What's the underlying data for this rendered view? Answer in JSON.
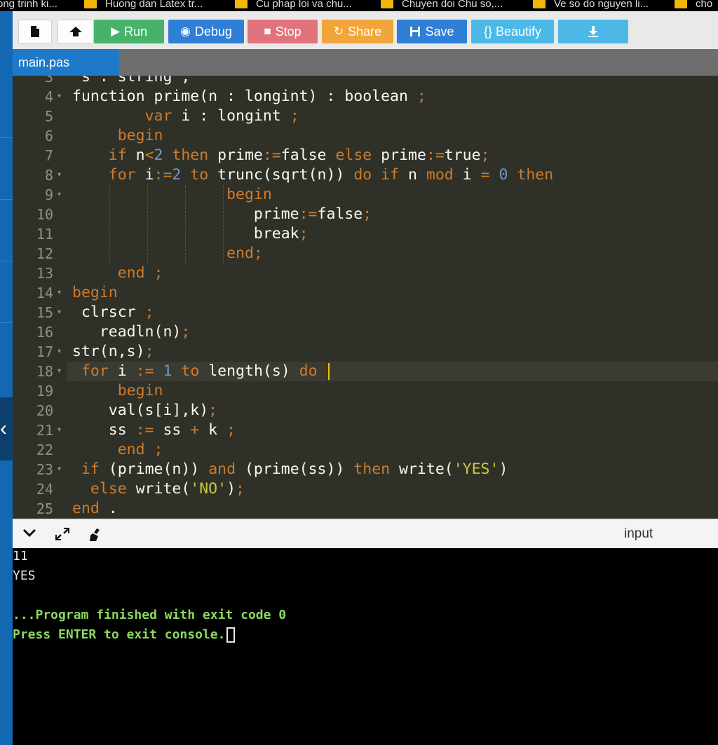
{
  "bookmarks": [
    {
      "label": "ong trinh ki..."
    },
    {
      "label": "Huong dan Latex tr..."
    },
    {
      "label": "Cu phap loi va chu..."
    },
    {
      "label": "Chuyen doi Chu so,..."
    },
    {
      "label": "Ve so do nguyen li..."
    },
    {
      "label": "cho"
    }
  ],
  "toolbar": {
    "run_label": "Run",
    "debug_label": "Debug",
    "stop_label": "Stop",
    "share_label": "Share",
    "save_label": "Save",
    "beautify_label": "{} Beautify"
  },
  "tab": {
    "name": "main.pas"
  },
  "editor": {
    "line_numbers": [
      "3",
      "4",
      "5",
      "6",
      "7",
      "8",
      "9",
      "10",
      "11",
      "12",
      "13",
      "14",
      "15",
      "16",
      "17",
      "18",
      "19",
      "20",
      "21",
      "22",
      "23",
      "24",
      "25"
    ],
    "active_line": 18
  },
  "console": {
    "input_label": "input",
    "lines": [
      "11",
      "YES",
      "",
      "...Program finished with exit code 0",
      "Press ENTER to exit console."
    ]
  },
  "colors": {
    "run": "#47b26a",
    "debug": "#2f7fd6",
    "stop": "#e0747a",
    "share": "#f0a63a",
    "save": "#2f7fd6",
    "beautify": "#4bb8e8",
    "tab_active": "#1f79c9",
    "editor_bg": "#2f3129",
    "keyword": "#ce7b2c",
    "number": "#6f99c6",
    "string": "#c7c93e",
    "console_green": "#8bd85e"
  },
  "icons": {
    "new_file": "new-file-icon",
    "upload": "upload-icon",
    "run": "play-icon",
    "debug": "debug-icon",
    "stop": "stop-icon",
    "share": "share-icon",
    "save": "floppy-icon",
    "download": "download-icon",
    "collapse": "chevron-down-icon",
    "expand": "expand-icon",
    "clear": "clear-console-icon"
  }
}
